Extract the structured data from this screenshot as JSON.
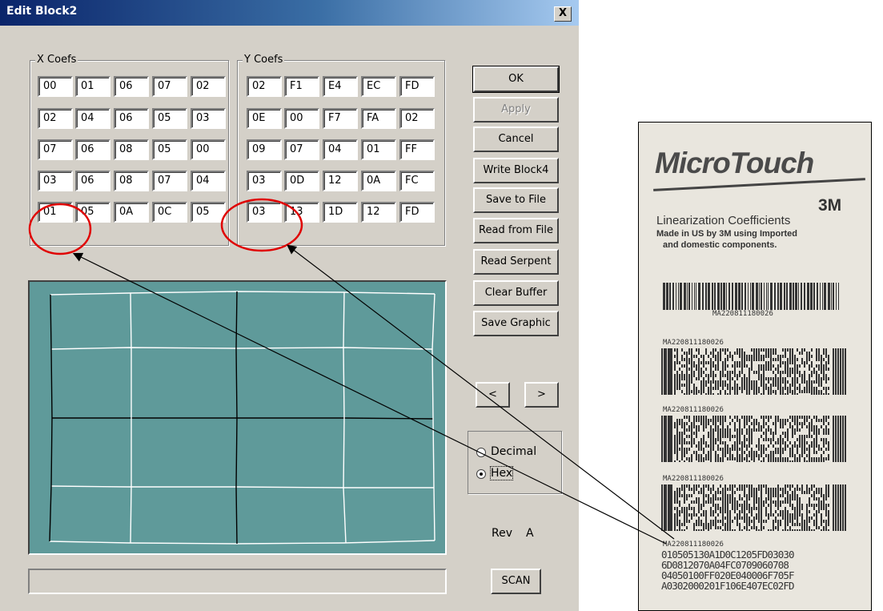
{
  "window": {
    "title": "Edit Block2",
    "close_label": "X"
  },
  "x_coefs": {
    "label": "X Coefs",
    "rows": [
      [
        "00",
        "01",
        "06",
        "07",
        "02"
      ],
      [
        "02",
        "04",
        "06",
        "05",
        "03"
      ],
      [
        "07",
        "06",
        "08",
        "05",
        "00"
      ],
      [
        "03",
        "06",
        "08",
        "07",
        "04"
      ],
      [
        "01",
        "05",
        "0A",
        "0C",
        "05"
      ]
    ]
  },
  "y_coefs": {
    "label": "Y Coefs",
    "rows": [
      [
        "02",
        "F1",
        "E4",
        "EC",
        "FD"
      ],
      [
        "0E",
        "00",
        "F7",
        "FA",
        "02"
      ],
      [
        "09",
        "07",
        "04",
        "01",
        "FF"
      ],
      [
        "03",
        "0D",
        "12",
        "0A",
        "FC"
      ],
      [
        "03",
        "13",
        "1D",
        "12",
        "FD"
      ]
    ]
  },
  "buttons": {
    "ok": "OK",
    "apply": "Apply",
    "cancel": "Cancel",
    "write_block": "Write Block4",
    "save_to_file": "Save to File",
    "read_from_file": "Read from File",
    "read_serpent": "Read Serpent",
    "clear_buffer": "Clear Buffer",
    "save_graphic": "Save Graphic",
    "prev": "<",
    "next": ">",
    "scan": "SCAN"
  },
  "format": {
    "decimal_label": "Decimal",
    "hex_label": "Hex",
    "selected": "Hex"
  },
  "rev": {
    "label": "Rev",
    "value": "A"
  },
  "label_photo": {
    "brand": "MicroTouch",
    "maker": "3M",
    "heading": "Linearization Coefficients",
    "line1": "Made in US by 3M using Imported",
    "line2": "and domestic components.",
    "serial_barcode": "MA220811180026",
    "serial_1": "MA220811180026",
    "serial_2": "MA220811180026",
    "serial_3": "MA220811180026",
    "serial_4": "MA220811180026",
    "code_lines": [
      "010505130A1D0C1205FD03030",
      "6D0812070A04FC0709060708",
      "04050100FF020E040006F705F",
      "A0302000201F106E407EC02FD"
    ]
  },
  "colors": {
    "canvas": "#5f9a9a",
    "annotation_circle": "#e00000",
    "title_gradient_start": "#0a246a"
  }
}
